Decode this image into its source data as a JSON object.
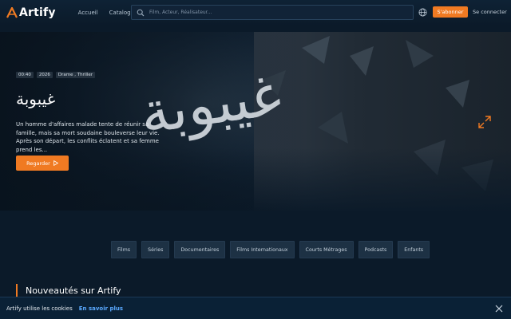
{
  "header": {
    "logo": "Artify",
    "nav": [
      "Accueil",
      "Catalogue"
    ],
    "search_placeholder": "Film, Acteur, Réalisateur...",
    "subscribe_label": "S'abonner",
    "login_label": "Se connecter"
  },
  "hero": {
    "badges": [
      "00:40",
      "2026",
      "Drame , Thriller"
    ],
    "title_logo": "غيبوبة",
    "synopsis": "Un homme d'affaires malade tente de réunir sa famille, mais sa mort soudaine bouleverse leur vie. Après son départ, les conflits éclatent et sa femme prend les...",
    "watch_label": "Regarder"
  },
  "categories": [
    "Films",
    "Séries",
    "Documentaires",
    "Films Internationaux",
    "Courts Métrages",
    "Podcasts",
    "Enfants"
  ],
  "section": {
    "title": "Nouveautés sur Artify"
  },
  "cookie": {
    "message": "Artify utilise les cookies",
    "link": "En savoir plus"
  },
  "colors": {
    "accent": "#f07a22",
    "background": "#0b1a29",
    "link": "#5aa9ff"
  }
}
